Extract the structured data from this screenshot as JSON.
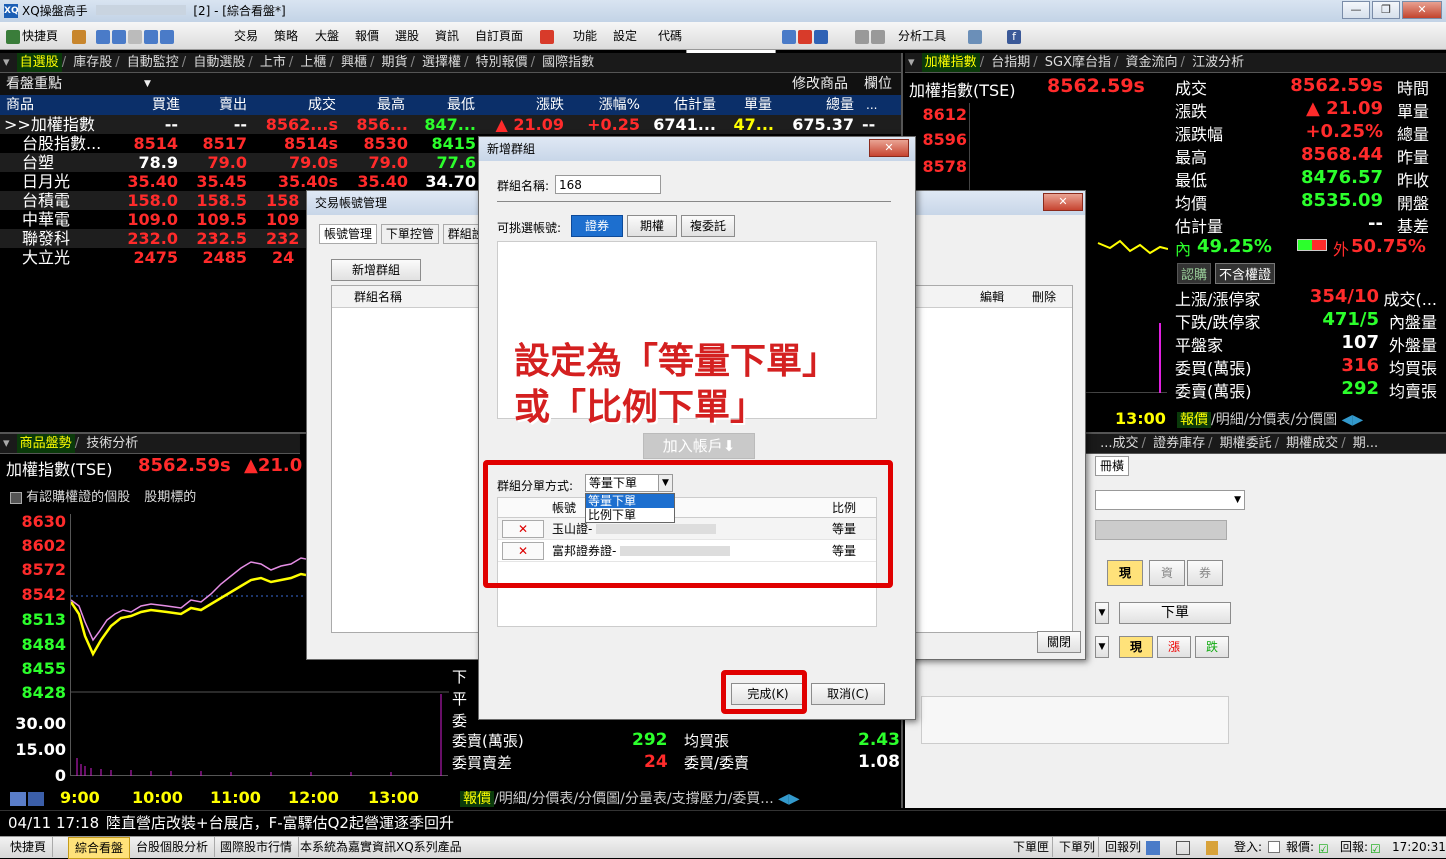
{
  "app": {
    "title": "XQ操盤高手",
    "title_suffix": "[2] - [綜合看盤*]",
    "logo": "XQ"
  },
  "toolbar": {
    "items": [
      "快捷頁",
      "交易",
      "策略",
      "大盤",
      "報價",
      "選股",
      "資訊",
      "自訂頁面",
      "功能",
      "設定",
      "代碼",
      "分析工具"
    ]
  },
  "left_panel": {
    "tabs": [
      "自選股",
      "庫存股",
      "自動監控",
      "自動選股",
      "上市",
      "上櫃",
      "興櫃",
      "期貨",
      "選擇權",
      "特別報價",
      "國際指數"
    ],
    "group_label": "看盤重點",
    "modify_label": "修改商品",
    "field_label": "欄位",
    "columns": [
      "商品",
      "買進",
      "賣出",
      "成交",
      "最高",
      "最低",
      "漲跌",
      "漲幅%",
      "估計量",
      "單量",
      "總量"
    ],
    "rows": [
      {
        "name": ">>加權指數",
        "buy": "--",
        "sell": "--",
        "deal": "8562...s",
        "high": "856...",
        "low": "847...",
        "chg": "▲ 21.09",
        "pct": "+0.25",
        "est": "6741...",
        "single": "47...",
        "total": "675.37"
      },
      {
        "name": "台股指數...",
        "buy": "8514",
        "sell": "8517",
        "deal": "8514s",
        "high": "8530",
        "low": "8415"
      },
      {
        "name": "台塑",
        "buy": "78.9",
        "sell": "79.0",
        "deal": "79.0s",
        "high": "79.0",
        "low": "77.6"
      },
      {
        "name": "日月光",
        "buy": "35.40",
        "sell": "35.45",
        "deal": "35.40s",
        "high": "35.40",
        "low": "34.70"
      },
      {
        "name": "台積電",
        "buy": "158.0",
        "sell": "158.5",
        "deal": "158"
      },
      {
        "name": "中華電",
        "buy": "109.0",
        "sell": "109.5",
        "deal": "109"
      },
      {
        "name": "聯發科",
        "buy": "232.0",
        "sell": "232.5",
        "deal": "232"
      },
      {
        "name": "大立光",
        "buy": "2475",
        "sell": "2485",
        "deal": "24"
      }
    ]
  },
  "right_panel": {
    "tabs": [
      "加權指數",
      "台指期",
      "SGX摩台指",
      "資金流向",
      "江波分析"
    ],
    "index_name": "加權指數(TSE)",
    "index_value": "8562.59s",
    "chart_prices": [
      "8612",
      "8596",
      "8578"
    ],
    "time_label": "13:00",
    "stats_left": [
      {
        "label": "成交",
        "value": "8562.59s",
        "color": "red"
      },
      {
        "label": "漲跌",
        "value": "▲ 21.09",
        "color": "red"
      },
      {
        "label": "漲跌幅",
        "value": "+0.25%",
        "color": "red"
      },
      {
        "label": "最高",
        "value": "8568.44",
        "color": "red"
      },
      {
        "label": "最低",
        "value": "8476.57",
        "color": "grn"
      },
      {
        "label": "均價",
        "value": "8535.09",
        "color": "grn"
      },
      {
        "label": "估計量",
        "value": "--",
        "color": "wht"
      }
    ],
    "stats_right": [
      "時間",
      "單量",
      "總量",
      "昨量",
      "昨收",
      "開盤",
      "基差"
    ],
    "inner_label": "內",
    "inner_value": "49.25%",
    "outer_label": "外",
    "outer_value": "50.75%",
    "warrant_btn1": "認購",
    "warrant_btn2": "不含權證",
    "breadth": [
      {
        "label": "上漲/漲停家",
        "value": "354/10",
        "color": "red",
        "right": "成交(..."
      },
      {
        "label": "下跌/跌停家",
        "value": "471/5",
        "color": "grn",
        "right": "內盤量"
      },
      {
        "label": "平盤家",
        "value": "107",
        "color": "wht",
        "right": "外盤量"
      },
      {
        "label": "委買(萬張)",
        "value": "316",
        "color": "red",
        "right": "均買張"
      },
      {
        "label": "委賣(萬張)",
        "value": "292",
        "color": "grn",
        "right": "均賣張"
      }
    ],
    "bottom_tabs": [
      "報價",
      "明細",
      "分價表",
      "分價圖"
    ]
  },
  "bottom_left": {
    "tabs": [
      "商品盤勢",
      "技術分析"
    ],
    "index_name": "加權指數(TSE)",
    "index_value": "8562.59s",
    "index_change": "▲21.0",
    "checkbox_label": "有認購權證的個股",
    "futures_label": "股期標的",
    "y_prices": [
      "8630",
      "8602",
      "8572",
      "8542",
      "8513",
      "8484",
      "8455",
      "8428"
    ],
    "y_volumes": [
      "30.00",
      "15.00",
      "0"
    ],
    "x_times": [
      "9:00",
      "10:00",
      "11:00",
      "12:00",
      "13:00"
    ],
    "stats": [
      {
        "label": "委賣(萬張)",
        "value": "292",
        "color": "grn",
        "label2": "均買張",
        "value2": "2.43"
      },
      {
        "label": "委買賣差",
        "value": "24",
        "color": "red",
        "label2": "委買/委賣",
        "value2": "1.08"
      }
    ],
    "partial_labels": [
      "下",
      "平",
      "委"
    ],
    "bottom_tabs": [
      "報價",
      "明細",
      "分價表",
      "分價圖",
      "分量表",
      "支撐壓力",
      "委買..."
    ]
  },
  "bottom_right": {
    "tabs": [
      "...成交",
      "證券庫存",
      "期權委託",
      "期權成交",
      "期..."
    ],
    "sub_tab": "冊橫",
    "btn_now": "現",
    "btn_fund": "資",
    "btn_loan": "券",
    "order_btn": "下單",
    "btn_now2": "現",
    "btn_up": "漲",
    "btn_down": "跌"
  },
  "account_dialog": {
    "title": "交易帳號管理",
    "tabs": [
      "帳號管理",
      "下單控管",
      "群組設"
    ],
    "add_group_btn": "新增群組",
    "col_group_name": "群組名稱",
    "col_edit": "編輯",
    "col_delete": "刪除",
    "close_btn": "關閉"
  },
  "group_dialog": {
    "title": "新增群組",
    "group_name_label": "群組名稱:",
    "group_name_value": "168",
    "account_label": "可挑選帳號:",
    "account_tabs": [
      "證券",
      "期權",
      "複委託"
    ],
    "overlay_text_1": "設定為「等量下單」",
    "overlay_text_2": "或「比例下單」",
    "add_account_btn": "加入帳戶⬇",
    "method_label": "群組分單方式:",
    "method_value": "等量下單",
    "method_options": [
      "等量下單",
      "比例下單"
    ],
    "col_account": "帳號",
    "col_ratio": "比例",
    "accounts": [
      {
        "name": "玉山證-",
        "ratio": "等量"
      },
      {
        "name": "富邦證券證-",
        "ratio": "等量"
      }
    ],
    "ok_btn": "完成(K)",
    "cancel_btn": "取消(C)"
  },
  "news_bar": {
    "datetime": "04/11 17:18",
    "headline": "陸直營店改裝+台展店，F-富驛估Q2起營運逐季回升"
  },
  "status_bar": {
    "tabs": [
      "快捷頁",
      "綜合看盤",
      "台股個股分析",
      "國際股市行情"
    ],
    "message": "本系統為嘉實資訊XQ系列產品",
    "buttons": [
      "下單匣",
      "下單列",
      "回報列"
    ],
    "login_label": "登入:",
    "quote_label": "報價:",
    "report_label": "回報:",
    "clock": "17:20:31"
  },
  "colors": {
    "up": "#ff2b2b",
    "down": "#2cff2c",
    "header_bg": "#0b2f69",
    "highlight": "#e00000",
    "selected_tab": "#1d6fcf"
  }
}
